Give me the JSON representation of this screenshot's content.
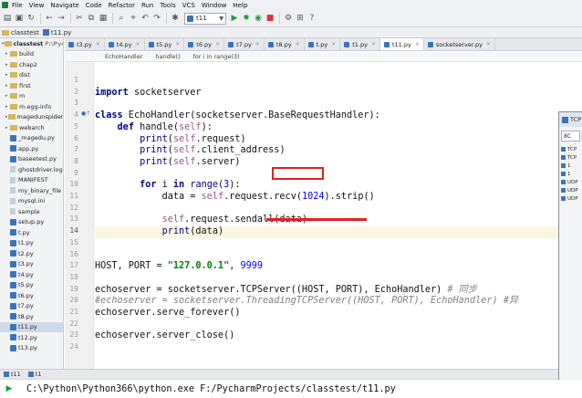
{
  "menubar": {
    "items": [
      "File",
      "View",
      "Navigate",
      "Code",
      "Refactor",
      "Run",
      "Tools",
      "VCS",
      "Window",
      "Help"
    ]
  },
  "toolbar": {
    "run_config": "t11"
  },
  "navbar": {
    "items": [
      "classtest",
      "t11.py"
    ]
  },
  "project_tree": {
    "items": [
      {
        "label": "classtest",
        "path": "F:\\Pycharm",
        "type": "root"
      },
      {
        "label": "build",
        "type": "folder"
      },
      {
        "label": "chap2",
        "type": "folder"
      },
      {
        "label": "dist",
        "type": "folder"
      },
      {
        "label": "first",
        "type": "folder"
      },
      {
        "label": "m",
        "type": "folder"
      },
      {
        "label": "m.egg-info",
        "type": "folder"
      },
      {
        "label": "magedunspider",
        "type": "folder"
      },
      {
        "label": "webarch",
        "type": "folder"
      },
      {
        "label": "_magedu.py",
        "type": "py"
      },
      {
        "label": "app.py",
        "type": "py"
      },
      {
        "label": "baseetest.py",
        "type": "py"
      },
      {
        "label": "ghostdriver.log",
        "type": "file"
      },
      {
        "label": "MANIFEST",
        "type": "file"
      },
      {
        "label": "my_binary_file",
        "type": "file"
      },
      {
        "label": "mysql.ini",
        "type": "file"
      },
      {
        "label": "sample",
        "type": "file"
      },
      {
        "label": "setup.py",
        "type": "py"
      },
      {
        "label": "t.py",
        "type": "py"
      },
      {
        "label": "t1.py",
        "type": "py"
      },
      {
        "label": "t2.py",
        "type": "py"
      },
      {
        "label": "t3.py",
        "type": "py"
      },
      {
        "label": "t4.py",
        "type": "py"
      },
      {
        "label": "t5.py",
        "type": "py"
      },
      {
        "label": "t6.py",
        "type": "py"
      },
      {
        "label": "t7.py",
        "type": "py"
      },
      {
        "label": "t8.py",
        "type": "py"
      },
      {
        "label": "t11.py",
        "type": "py",
        "selected": true
      },
      {
        "label": "t12.py",
        "type": "py"
      },
      {
        "label": "t13.py",
        "type": "py"
      }
    ]
  },
  "editor_tabs": [
    {
      "label": "t3.py"
    },
    {
      "label": "t4.py"
    },
    {
      "label": "t5.py"
    },
    {
      "label": "t6.py"
    },
    {
      "label": "t7.py"
    },
    {
      "label": "t8.py"
    },
    {
      "label": "t.py"
    },
    {
      "label": "t1.py"
    },
    {
      "label": "t11.py",
      "active": true
    },
    {
      "label": "socketserver.py"
    }
  ],
  "breadcrumb": [
    "EchoHandler",
    "handle()",
    "for i in range(3)"
  ],
  "editor": {
    "current_line": 14,
    "lines": [
      {
        "n": 1,
        "html": ""
      },
      {
        "n": 2,
        "html": "<span class=\"kw\">import</span> socketserver"
      },
      {
        "n": 3,
        "html": ""
      },
      {
        "n": 4,
        "html": "<span class=\"kw\">class</span> EchoHandler(socketserver.BaseRequestHandler):"
      },
      {
        "n": 5,
        "html": "    <span class=\"kw\">def</span> handle(<span class=\"self\">self</span>):"
      },
      {
        "n": 6,
        "html": "        <span class=\"fn\">print</span>(<span class=\"self\">self</span>.request)"
      },
      {
        "n": 7,
        "html": "        <span class=\"fn\">print</span>(<span class=\"self\">self</span>.client_address)"
      },
      {
        "n": 8,
        "html": "        <span class=\"fn\">print</span>(<span class=\"self\">self</span>.server)"
      },
      {
        "n": 9,
        "html": ""
      },
      {
        "n": 10,
        "html": "        <span class=\"kw\">for</span> i <span class=\"kw\">in</span> <span class=\"fn\">range</span>(<span class=\"num\">3</span>):"
      },
      {
        "n": 11,
        "html": "            data = <span class=\"self\">self</span>.request.recv(<span class=\"num\">1024</span>).strip()"
      },
      {
        "n": 12,
        "html": ""
      },
      {
        "n": 13,
        "html": "            <span class=\"self\">self</span>.request.sendall(data)"
      },
      {
        "n": 14,
        "html": "            <span class=\"fn\">print</span>(data)"
      },
      {
        "n": 15,
        "html": ""
      },
      {
        "n": 16,
        "html": ""
      },
      {
        "n": 17,
        "html": "HOST, PORT = <span class=\"str\">\"127.0.0.1\"</span>, <span class=\"num\">9999</span>"
      },
      {
        "n": 18,
        "html": ""
      },
      {
        "n": 19,
        "html": "echoserver = socketserver.TCPServer((HOST, PORT), EchoHandler) <span class=\"cm\"># 同步</span>"
      },
      {
        "n": 20,
        "html": "<span class=\"cm\">#echoserver = socketserver.ThreadingTCPServer((HOST, PORT), EchoHandler) #异</span>"
      },
      {
        "n": 21,
        "html": "echoserver.serve_forever()"
      },
      {
        "n": 22,
        "html": ""
      },
      {
        "n": 23,
        "html": "echoserver.server_close()"
      },
      {
        "n": 24,
        "html": ""
      }
    ]
  },
  "bottom_tabs": [
    "t11",
    "t1"
  ],
  "console": {
    "command": "C:\\Python\\Python366\\python.exe F:/PycharmProjects/classtest/t11.py"
  },
  "float_window": {
    "title": "TCP",
    "button": "8C",
    "rows": [
      "TCP",
      "TCP",
      "1",
      "1",
      "UDP",
      "UDP",
      "UDP"
    ]
  },
  "colors": {
    "annotation": "#e02020",
    "current_line": "#fbf6df",
    "selection": "#cfd9ea"
  }
}
